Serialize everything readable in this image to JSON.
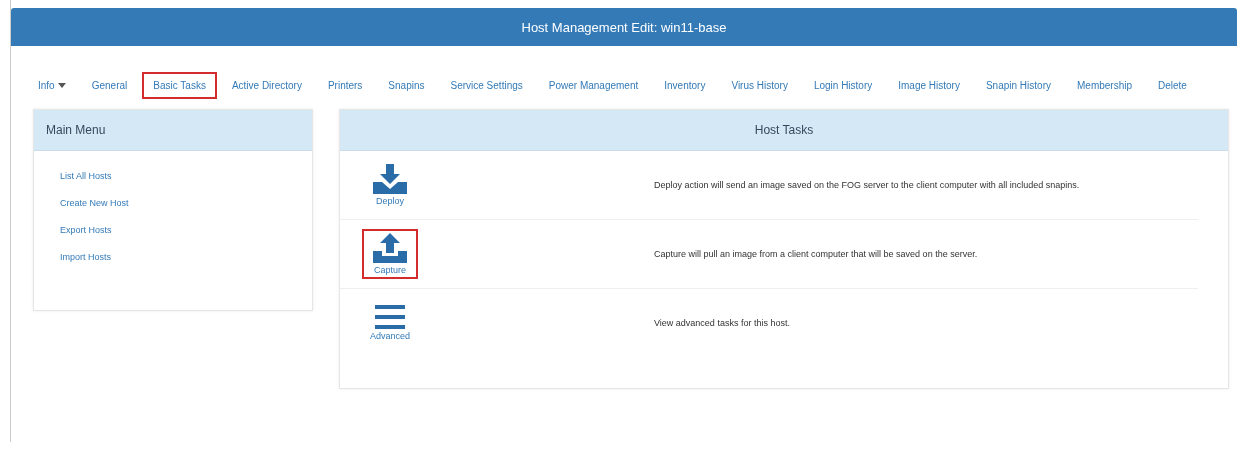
{
  "title": "Host Management Edit: win11-base",
  "nav": [
    {
      "label": "Info",
      "dropdown": true,
      "highlighted": false
    },
    {
      "label": "General",
      "dropdown": false,
      "highlighted": false
    },
    {
      "label": "Basic Tasks",
      "dropdown": false,
      "highlighted": true
    },
    {
      "label": "Active Directory",
      "dropdown": false,
      "highlighted": false
    },
    {
      "label": "Printers",
      "dropdown": false,
      "highlighted": false
    },
    {
      "label": "Snapins",
      "dropdown": false,
      "highlighted": false
    },
    {
      "label": "Service Settings",
      "dropdown": false,
      "highlighted": false
    },
    {
      "label": "Power Management",
      "dropdown": false,
      "highlighted": false
    },
    {
      "label": "Inventory",
      "dropdown": false,
      "highlighted": false
    },
    {
      "label": "Virus History",
      "dropdown": false,
      "highlighted": false
    },
    {
      "label": "Login History",
      "dropdown": false,
      "highlighted": false
    },
    {
      "label": "Image History",
      "dropdown": false,
      "highlighted": false
    },
    {
      "label": "Snapin History",
      "dropdown": false,
      "highlighted": false
    },
    {
      "label": "Membership",
      "dropdown": false,
      "highlighted": false
    },
    {
      "label": "Delete",
      "dropdown": false,
      "highlighted": false
    }
  ],
  "menu": {
    "title": "Main Menu",
    "items": [
      "List All Hosts",
      "Create New Host",
      "Export Hosts",
      "Import Hosts"
    ]
  },
  "tasks": {
    "title": "Host Tasks",
    "items": [
      {
        "kind": "download",
        "label": "Deploy",
        "description": "Deploy action will send an image saved on the FOG server to the client computer with all included snapins.",
        "highlighted": false
      },
      {
        "kind": "upload",
        "label": "Capture",
        "description": "Capture will pull an image from a client computer that will be saved on the server.",
        "highlighted": true
      },
      {
        "kind": "menu",
        "label": "Advanced",
        "description": "View advanced tasks for this host.",
        "highlighted": false
      }
    ]
  }
}
